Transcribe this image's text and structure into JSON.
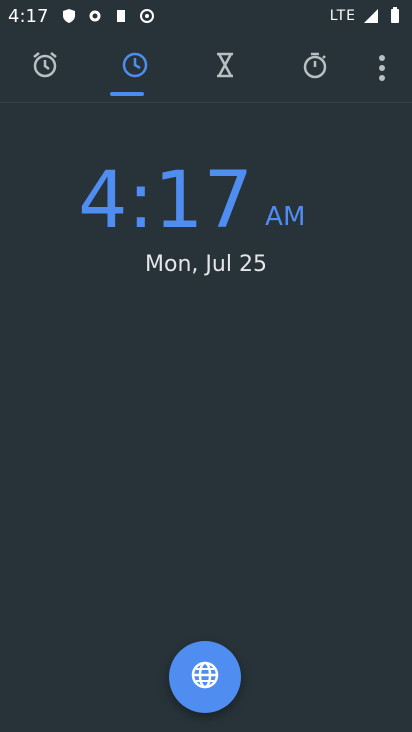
{
  "statusbar": {
    "time": "4:17",
    "network": "LTE",
    "icons": [
      "shield-icon",
      "gear-icon",
      "sd-card-icon",
      "signal-icon",
      "battery-icon"
    ]
  },
  "tabs": [
    {
      "name": "alarm-tab",
      "icon": "alarm-icon"
    },
    {
      "name": "clock-tab",
      "icon": "clock-icon",
      "active": true
    },
    {
      "name": "timer-tab",
      "icon": "hourglass-icon"
    },
    {
      "name": "stopwatch-tab",
      "icon": "stopwatch-icon"
    }
  ],
  "clock": {
    "time": "4:17",
    "ampm": "AM",
    "date": "Mon, Jul 25"
  },
  "colors": {
    "background": "#273339",
    "accent": "#4f8df0"
  }
}
